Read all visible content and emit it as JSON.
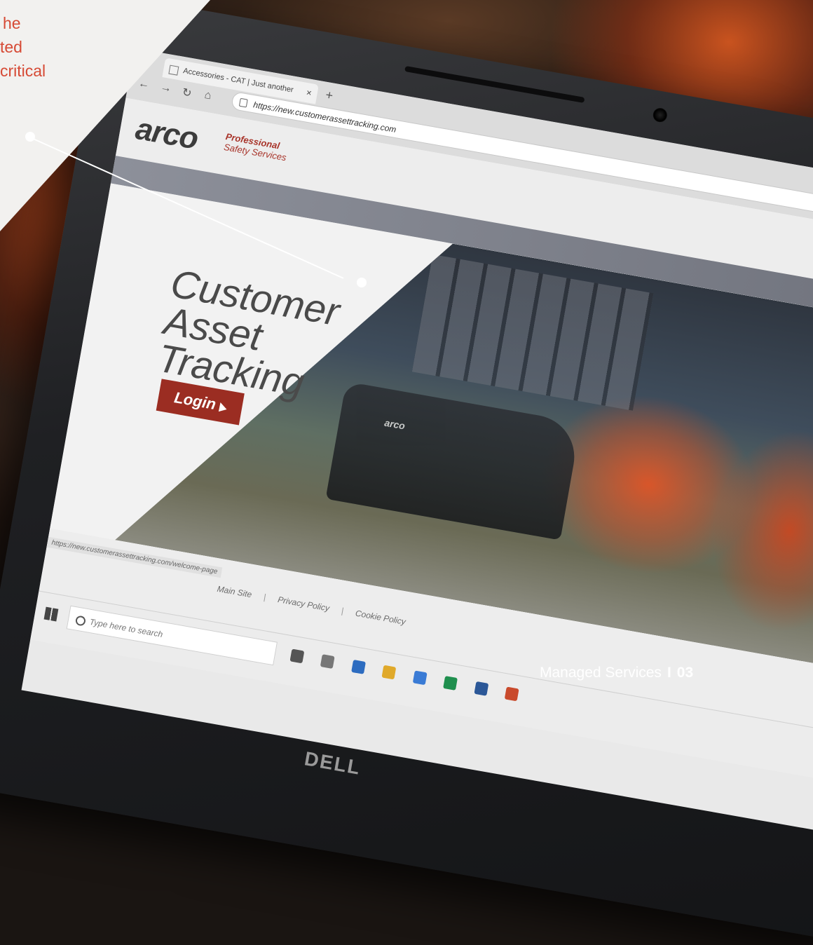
{
  "callout": {
    "lines": [
      "he",
      "ted",
      "critical"
    ]
  },
  "browser": {
    "tab_title": "Accessories - CAT | Just another",
    "tab_close": "×",
    "tab_new": "+",
    "url": "https://new.customerassettracking.com",
    "status_url": "https://new.customerassettracking.com/welcome-page"
  },
  "site": {
    "logo_main": "arco",
    "logo_sub_1": "Professional",
    "logo_sub_2": "Safety Services",
    "hero_title": [
      "Customer",
      "Asset",
      "Tracking"
    ],
    "login_label": "Login",
    "van_label": "arco",
    "footer_links": [
      "Main Site",
      "Privacy Policy",
      "Cookie Policy"
    ],
    "footer_sep": "|"
  },
  "taskbar": {
    "search_placeholder": "Type here to search"
  },
  "laptop": {
    "brand": "DELL"
  },
  "page_footer": {
    "label": "Managed Services",
    "separator": "I",
    "page_number": "03"
  },
  "colors": {
    "accent_red": "#d64a35",
    "login_red": "#9b2d22"
  }
}
